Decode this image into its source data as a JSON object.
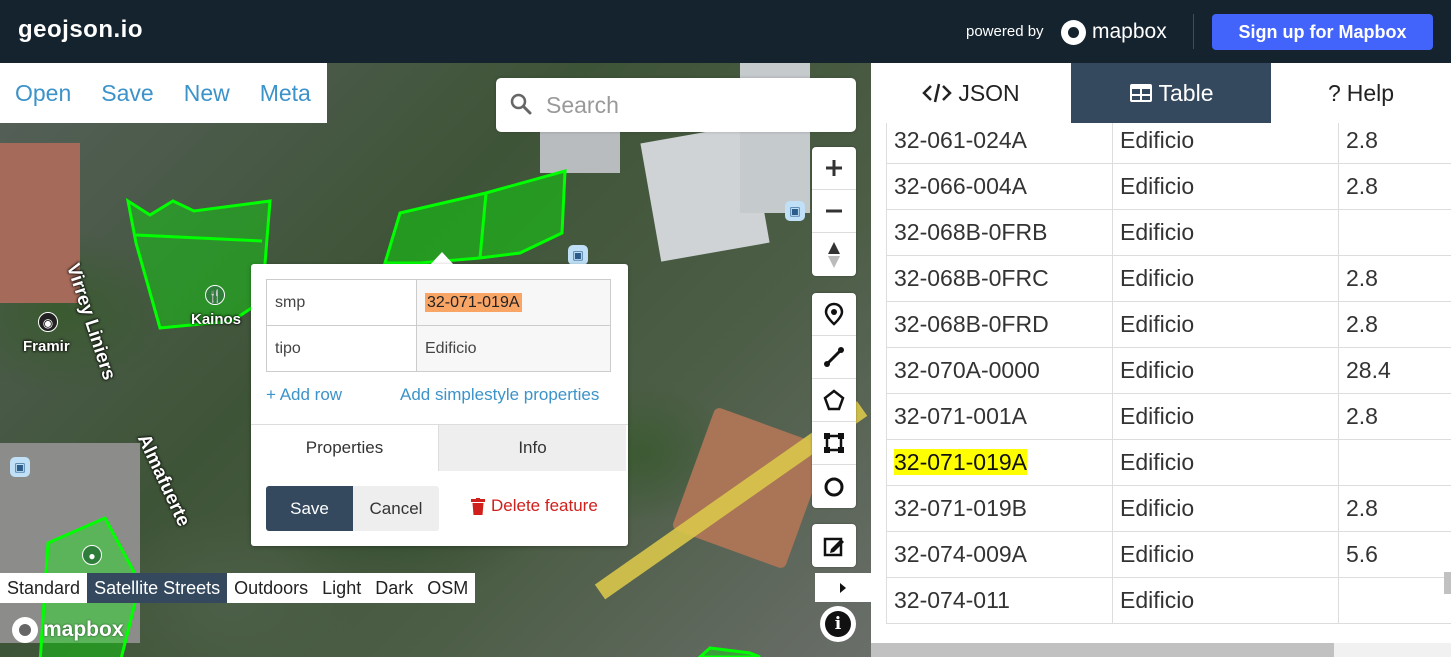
{
  "header": {
    "brand": "geojson.io",
    "powered_by": "powered by",
    "mapbox": "mapbox",
    "signup": "Sign up for Mapbox"
  },
  "file_menu": [
    "Open",
    "Save",
    "New",
    "Meta"
  ],
  "search": {
    "placeholder": "Search"
  },
  "map": {
    "street_labels": [
      "Virrey Liniers",
      "Almafuerte"
    ],
    "poi_labels": [
      "Kainos",
      "Framir"
    ],
    "styles": [
      "Standard",
      "Satellite Streets",
      "Outdoors",
      "Light",
      "Dark",
      "OSM"
    ],
    "active_style": "Satellite Streets",
    "logo": "mapbox"
  },
  "popup": {
    "rows": [
      {
        "key": "smp",
        "value": "32-071-019A"
      },
      {
        "key": "tipo",
        "value": "Edificio"
      }
    ],
    "add_row": "+ Add row",
    "add_simplestyle": "Add simplestyle properties",
    "tabs": [
      "Properties",
      "Info"
    ],
    "save": "Save",
    "cancel": "Cancel",
    "delete": "Delete feature"
  },
  "panel": {
    "tabs": [
      "JSON",
      "Table",
      "Help"
    ],
    "active_tab": "Table",
    "rows": [
      {
        "smp": "32-061-024A",
        "tipo": "Edificio",
        "val": "2.8"
      },
      {
        "smp": "32-066-004A",
        "tipo": "Edificio",
        "val": "2.8"
      },
      {
        "smp": "32-068B-0FRB",
        "tipo": "Edificio",
        "val": ""
      },
      {
        "smp": "32-068B-0FRC",
        "tipo": "Edificio",
        "val": "2.8"
      },
      {
        "smp": "32-068B-0FRD",
        "tipo": "Edificio",
        "val": "2.8"
      },
      {
        "smp": "32-070A-0000",
        "tipo": "Edificio",
        "val": "28.4"
      },
      {
        "smp": "32-071-001A",
        "tipo": "Edificio",
        "val": "2.8"
      },
      {
        "smp": "32-071-019A",
        "tipo": "Edificio",
        "val": ""
      },
      {
        "smp": "32-071-019B",
        "tipo": "Edificio",
        "val": "2.8"
      },
      {
        "smp": "32-074-009A",
        "tipo": "Edificio",
        "val": "5.6"
      },
      {
        "smp": "32-074-011",
        "tipo": "Edificio",
        "val": ""
      }
    ],
    "selected_row": "32-071-019A"
  },
  "colors": {
    "topbar": "#14232e",
    "accent_blue": "#4264fb",
    "link": "#3c93c9",
    "active_tab": "#34495e",
    "polygon_stroke": "#00ff00",
    "highlight": "#ffff00",
    "delete_red": "#d0201b"
  }
}
